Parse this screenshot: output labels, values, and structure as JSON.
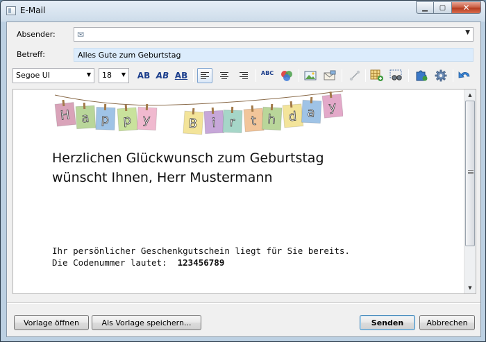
{
  "window": {
    "title": "E-Mail"
  },
  "form": {
    "sender_label": "Absender:",
    "sender_value": "",
    "subject_label": "Betreff:",
    "subject_value": "Alles Gute zum Geburtstag"
  },
  "toolbar": {
    "font_family": "Segoe UI",
    "font_size": "18",
    "bold_label": "AB",
    "italic_label": "AB",
    "underline_label": "AB",
    "spellcheck_label": "ABC"
  },
  "editor": {
    "banner_letters": [
      "H",
      "a",
      "p",
      "p",
      "y",
      "B",
      "i",
      "r",
      "t",
      "h",
      "d",
      "a",
      "y"
    ],
    "banner_colors": [
      "#d9a3b9",
      "#b9d69a",
      "#9fc3e6",
      "#c9e29c",
      "#f0b9cf",
      "#f3e49a",
      "#c7a7d9",
      "#a6d6c8",
      "#f2c59a",
      "#b9d69a",
      "#f3e49a",
      "#9fc3e6",
      "#e3a9c9"
    ],
    "greeting_line1": "Herzlichen Glückwunsch zum Geburtstag",
    "greeting_line2": "wünscht Ihnen, Herr Mustermann",
    "voucher_line1": "Ihr persönlicher Geschenkgutschein liegt für Sie bereits.",
    "voucher_line2_prefix": "Die Codenummer lautet:  ",
    "voucher_code": "123456789"
  },
  "buttons": {
    "open_template": "Vorlage öffnen",
    "save_template": "Als Vorlage speichern...",
    "send": "Senden",
    "cancel": "Abbrechen"
  }
}
